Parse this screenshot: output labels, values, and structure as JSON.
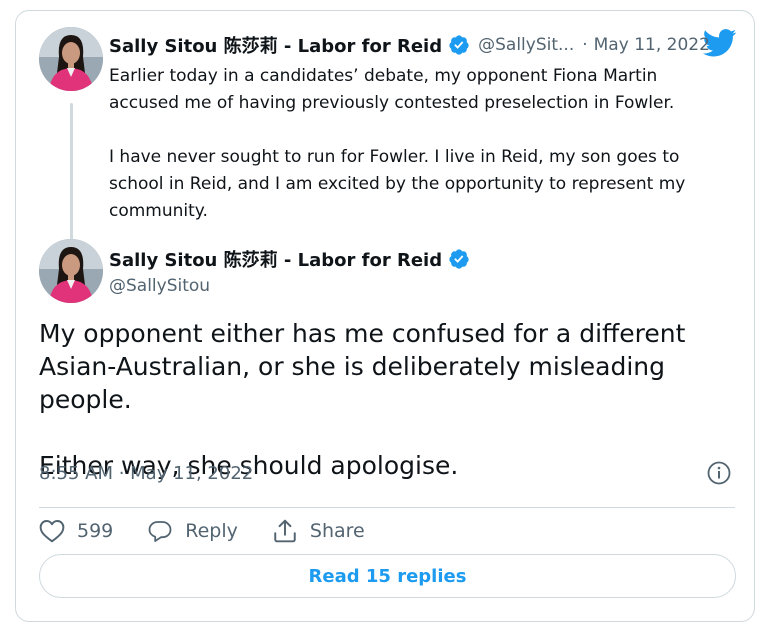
{
  "quoted_tweet": {
    "author_name": "Sally Sitou 陈莎莉 - Labor for Reid",
    "handle": "@SallySit...",
    "separator": "·",
    "date": "May 11, 2022",
    "paragraphs": [
      "Earlier today in a candidates’ debate, my opponent Fiona Martin accused me of having previously contested preselection in Fowler.",
      "I have never sought to run for Fowler. I live in Reid, my son goes to school in Reid, and I am excited by the opportunity to represent my community."
    ]
  },
  "main_tweet": {
    "author_name": "Sally Sitou 陈莎莉 - Labor for Reid",
    "handle": "@SallySitou",
    "paragraphs": [
      "My opponent either has me confused for a different Asian-Australian, or she is deliberately misleading people.",
      "Either way, she should apologise."
    ],
    "timestamp": "8:55 AM · May 11, 2022"
  },
  "actions": {
    "like_count": "599",
    "reply_label": "Reply",
    "share_label": "Share"
  },
  "read_replies_label": "Read 15 replies",
  "colors": {
    "accent": "#1d9bf0",
    "text": "#0f1419",
    "muted": "#536471",
    "border": "#cfd9de"
  }
}
